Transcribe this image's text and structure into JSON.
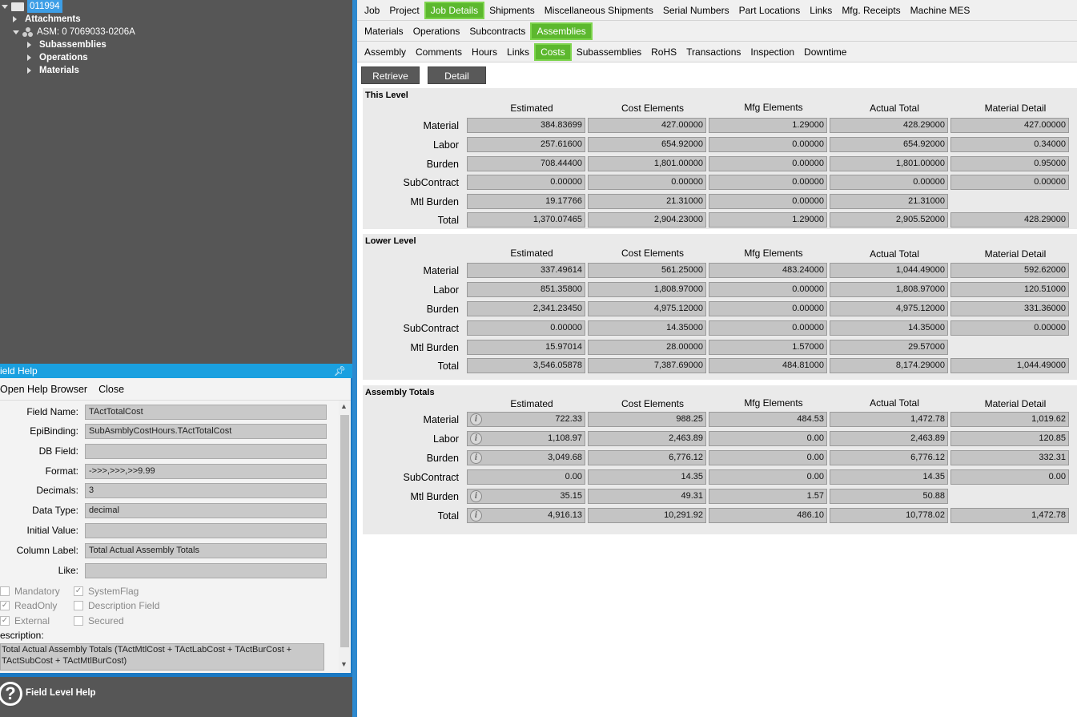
{
  "tree": {
    "root": "011994",
    "attachments": "Attachments",
    "asm": "ASM: 0 7069033-0206A",
    "subassemblies": "Subassemblies",
    "operations": "Operations",
    "materials": "Materials"
  },
  "field_help": {
    "title": "ield Help",
    "open_help_browser": "Open Help Browser",
    "close": "Close",
    "fields": [
      {
        "label": "Field Name:",
        "value": "TActTotalCost"
      },
      {
        "label": "EpiBinding:",
        "value": "SubAsmblyCostHours.TActTotalCost"
      },
      {
        "label": "DB Field:",
        "value": ""
      },
      {
        "label": "Format:",
        "value": "->>>,>>>,>>9.99"
      },
      {
        "label": "Decimals:",
        "value": "3"
      },
      {
        "label": "Data Type:",
        "value": "decimal"
      },
      {
        "label": "Initial Value:",
        "value": ""
      },
      {
        "label": "Column Label:",
        "value": "Total Actual Assembly Totals"
      },
      {
        "label": "Like:",
        "value": ""
      }
    ],
    "checks": [
      {
        "label": "Mandatory",
        "checked": false
      },
      {
        "label": "SystemFlag",
        "checked": true
      },
      {
        "label": "ReadOnly",
        "checked": true
      },
      {
        "label": "Description Field",
        "checked": false
      },
      {
        "label": "External",
        "checked": true
      },
      {
        "label": "Secured",
        "checked": false
      }
    ],
    "description_label": "escription:",
    "description": "Total Actual Assembly Totals (TActMtlCost + TActLabCost + TActBurCost + TActSubCost + TActMtlBurCost)",
    "footer_label": "Field Level Help"
  },
  "tabs_l1": [
    "Job",
    "Project",
    "Job Details",
    "Shipments",
    "Miscellaneous Shipments",
    "Serial Numbers",
    "Part Locations",
    "Links",
    "Mfg. Receipts",
    "Machine MES"
  ],
  "tabs_l1_active": 2,
  "tabs_l2": [
    "Materials",
    "Operations",
    "Subcontracts",
    "Assemblies"
  ],
  "tabs_l2_active": 3,
  "tabs_l3": [
    "Assembly",
    "Comments",
    "Hours",
    "Links",
    "Costs",
    "Subassemblies",
    "RoHS",
    "Transactions",
    "Inspection",
    "Downtime"
  ],
  "tabs_l3_active": 4,
  "buttons": {
    "retrieve": "Retrieve",
    "detail": "Detail"
  },
  "columns": [
    "Estimated",
    "Cost Elements",
    "Mfg Elements",
    "Actual Total",
    "Material Detail"
  ],
  "row_labels": [
    "Material",
    "Labor",
    "Burden",
    "SubContract",
    "Mtl Burden",
    "Total"
  ],
  "sections": [
    {
      "title": "This Level",
      "rows": [
        [
          "384.83699",
          "427.00000",
          "1.29000",
          "428.29000",
          "427.00000"
        ],
        [
          "257.61600",
          "654.92000",
          "0.00000",
          "654.92000",
          "0.34000"
        ],
        [
          "708.44400",
          "1,801.00000",
          "0.00000",
          "1,801.00000",
          "0.95000"
        ],
        [
          "0.00000",
          "0.00000",
          "0.00000",
          "0.00000",
          "0.00000"
        ],
        [
          "19.17766",
          "21.31000",
          "0.00000",
          "21.31000",
          null
        ],
        [
          "1,370.07465",
          "2,904.23000",
          "1.29000",
          "2,905.52000",
          "428.29000"
        ]
      ]
    },
    {
      "title": "Lower Level",
      "rows": [
        [
          "337.49614",
          "561.25000",
          "483.24000",
          "1,044.49000",
          "592.62000"
        ],
        [
          "851.35800",
          "1,808.97000",
          "0.00000",
          "1,808.97000",
          "120.51000"
        ],
        [
          "2,341.23450",
          "4,975.12000",
          "0.00000",
          "4,975.12000",
          "331.36000"
        ],
        [
          "0.00000",
          "14.35000",
          "0.00000",
          "14.35000",
          "0.00000"
        ],
        [
          "15.97014",
          "28.00000",
          "1.57000",
          "29.57000",
          null
        ],
        [
          "3,546.05878",
          "7,387.69000",
          "484.81000",
          "8,174.29000",
          "1,044.49000"
        ]
      ]
    },
    {
      "title": "Assembly Totals",
      "rows": [
        [
          "722.33",
          "988.25",
          "484.53",
          "1,472.78",
          "1,019.62"
        ],
        [
          "1,108.97",
          "2,463.89",
          "0.00",
          "2,463.89",
          "120.85"
        ],
        [
          "3,049.68",
          "6,776.12",
          "0.00",
          "6,776.12",
          "332.31"
        ],
        [
          "0.00",
          "14.35",
          "0.00",
          "14.35",
          "0.00"
        ],
        [
          "35.15",
          "49.31",
          "1.57",
          "50.88",
          null
        ],
        [
          "4,916.13",
          "10,291.92",
          "486.10",
          "10,778.02",
          "1,472.78"
        ]
      ],
      "info_rows": [
        true,
        true,
        true,
        false,
        true,
        true
      ]
    }
  ]
}
